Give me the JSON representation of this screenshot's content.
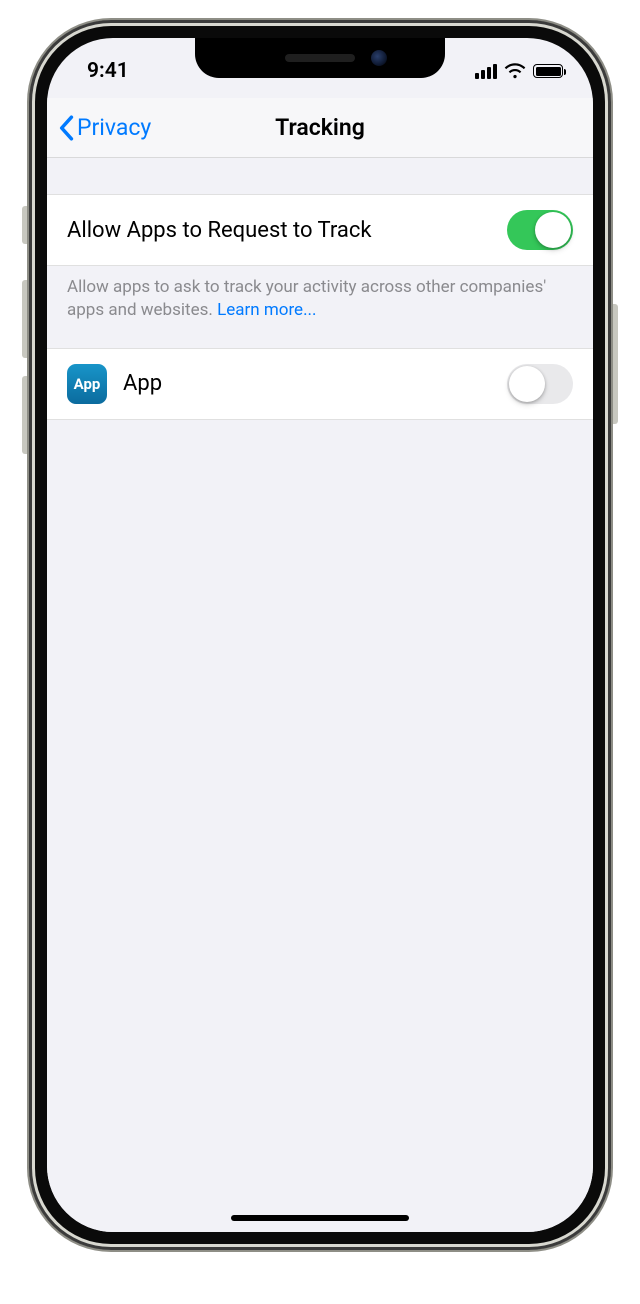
{
  "status": {
    "time": "9:41"
  },
  "nav": {
    "back_label": "Privacy",
    "title": "Tracking"
  },
  "tracking": {
    "allow_label": "Allow Apps to Request to Track",
    "allow_on": true,
    "footer_text": "Allow apps to ask to track your activity across other companies' apps and websites. ",
    "learn_more": "Learn more..."
  },
  "apps": [
    {
      "name": "App",
      "icon_label": "App",
      "tracking_on": false
    }
  ]
}
